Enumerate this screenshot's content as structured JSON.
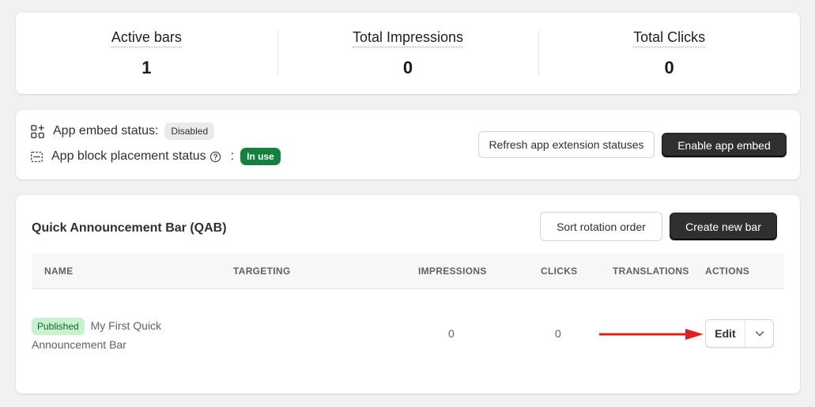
{
  "stats": [
    {
      "label": "Active bars",
      "value": "1"
    },
    {
      "label": "Total Impressions",
      "value": "0"
    },
    {
      "label": "Total Clicks",
      "value": "0"
    }
  ],
  "status": {
    "embed_label": "App embed status:",
    "embed_badge": "Disabled",
    "block_label": "App block placement status",
    "block_colon": ":",
    "block_badge": "In use",
    "refresh_button": "Refresh app extension statuses",
    "enable_button": "Enable app embed"
  },
  "qab": {
    "title": "Quick Announcement Bar (QAB)",
    "sort_button": "Sort rotation order",
    "create_button": "Create new bar",
    "columns": [
      "NAME",
      "TARGETING",
      "IMPRESSIONS",
      "CLICKS",
      "TRANSLATIONS",
      "ACTIONS"
    ],
    "rows": [
      {
        "status": "Published",
        "name": "My First Quick Announcement Bar",
        "impressions": "0",
        "clicks": "0",
        "edit": "Edit"
      }
    ]
  },
  "colors": {
    "accent_dark": "#303030",
    "in_use_green": "#13803f",
    "published_bg": "#c6f2d0",
    "annotation_arrow": "#e02020"
  },
  "icons": [
    "apps-icon",
    "block-placement-icon",
    "help-circle-icon",
    "chevron-down-icon",
    "red-arrow-annotation"
  ]
}
